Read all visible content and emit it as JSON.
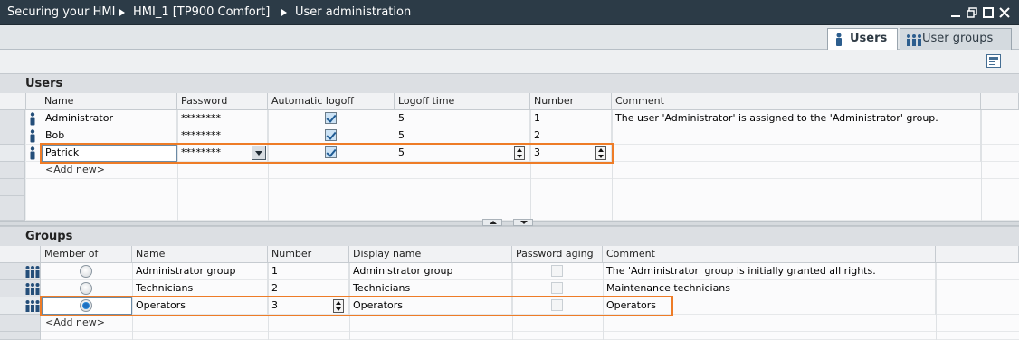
{
  "titlebar": {
    "crumbs": [
      "Securing your HMI",
      "HMI_1 [TP900 Comfort]",
      "User administration"
    ]
  },
  "tabs": [
    {
      "label": "Users",
      "icon": "user-icon",
      "active": true
    },
    {
      "label": "User groups",
      "icon": "user-group-icon",
      "active": false
    }
  ],
  "users": {
    "title": "Users",
    "columns": [
      "Name",
      "Password",
      "Automatic logoff",
      "Logoff time",
      "Number",
      "Comment"
    ],
    "rows": [
      {
        "name": "Administrator",
        "password": "********",
        "auto_logoff": true,
        "logoff_time": "5",
        "number": "1",
        "comment": "The user 'Administrator' is assigned to the 'Administrator' group."
      },
      {
        "name": "Bob",
        "password": "********",
        "auto_logoff": true,
        "logoff_time": "5",
        "number": "2",
        "comment": ""
      },
      {
        "name": "Patrick",
        "password": "********",
        "auto_logoff": true,
        "logoff_time": "5",
        "number": "3",
        "comment": ""
      }
    ],
    "add_new": "<Add new>"
  },
  "groups": {
    "title": "Groups",
    "columns": [
      "Member of",
      "Name",
      "Number",
      "Display name",
      "Password aging",
      "Comment"
    ],
    "rows": [
      {
        "member": false,
        "name": "Administrator group",
        "number": "1",
        "display_name": "Administrator group",
        "password_aging": false,
        "comment": "The 'Administrator' group is initially granted all rights."
      },
      {
        "member": false,
        "name": "Technicians",
        "number": "2",
        "display_name": "Technicians",
        "password_aging": false,
        "comment": "Maintenance technicians"
      },
      {
        "member": true,
        "name": "Operators",
        "number": "3",
        "display_name": "Operators",
        "password_aging": false,
        "comment": "Operators"
      }
    ],
    "add_new": "<Add new>"
  },
  "colors": {
    "titlebar": "#2c3b47",
    "highlight": "#ee7c27",
    "accent": "#1f6fbf"
  }
}
